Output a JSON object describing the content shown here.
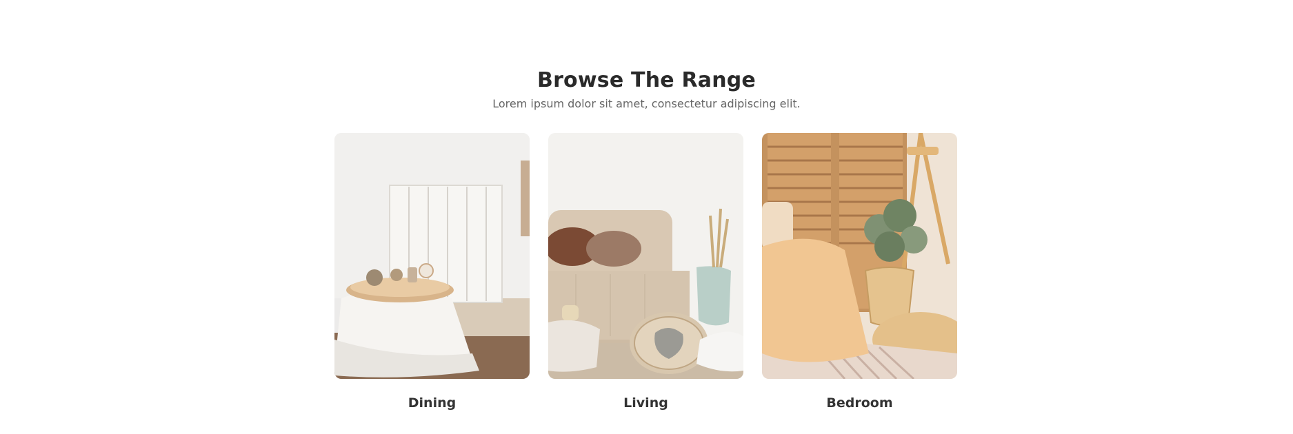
{
  "section": {
    "title": "Browse The Range",
    "subtitle": "Lorem ipsum dolor sit amet, consectetur adipiscing elit."
  },
  "categories": [
    {
      "label": "Dining"
    },
    {
      "label": "Living"
    },
    {
      "label": "Bedroom"
    }
  ]
}
